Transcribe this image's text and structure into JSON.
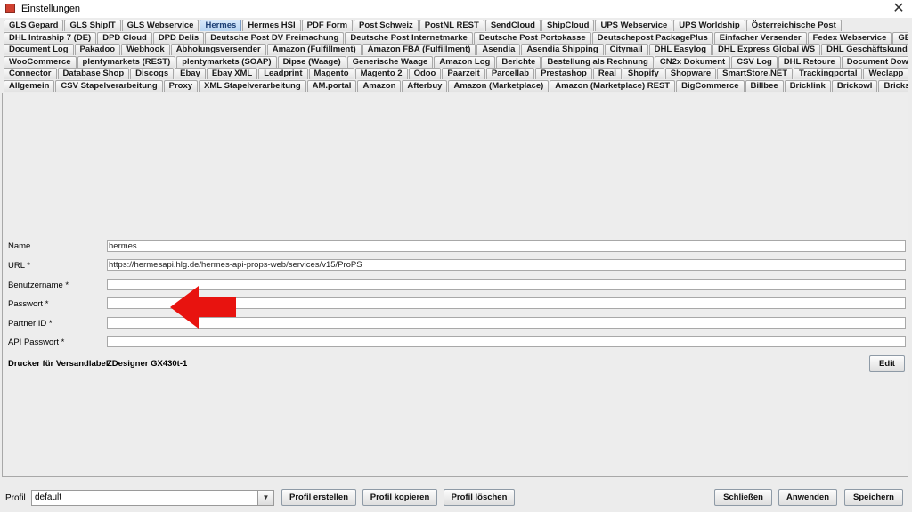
{
  "window": {
    "title": "Einstellungen",
    "close_glyph": "✕"
  },
  "tabs": {
    "rows": [
      [
        "GLS Gepard",
        "GLS ShipIT",
        "GLS Webservice",
        "Hermes",
        "Hermes HSI",
        "PDF Form",
        "Post Schweiz",
        "PostNL REST",
        "SendCloud",
        "ShipCloud",
        "UPS Webservice",
        "UPS Worldship",
        "Österreichische Post"
      ],
      [
        "DHL Intraship 7 (DE)",
        "DPD Cloud",
        "DPD Delis",
        "Deutsche Post DV Freimachung",
        "Deutsche Post Internetmarke",
        "Deutsche Post Portokasse",
        "Deutschepost PackagePlus",
        "Einfacher Versender",
        "Fedex Webservice",
        "GEL Express"
      ],
      [
        "Document Log",
        "Pakadoo",
        "Webhook",
        "Abholungsversender",
        "Amazon (Fulfillment)",
        "Amazon FBA (Fulfillment)",
        "Asendia",
        "Asendia Shipping",
        "Citymail",
        "DHL Easylog",
        "DHL Express Global WS",
        "DHL Geschäftskundenversand"
      ],
      [
        "WooCommerce",
        "plentymarkets (REST)",
        "plentymarkets (SOAP)",
        "Dipse (Waage)",
        "Generische Waage",
        "Amazon Log",
        "Berichte",
        "Bestellung als Rechnung",
        "CN2x Dokument",
        "CSV Log",
        "DHL Retoure",
        "Document Downloader"
      ],
      [
        "Connector",
        "Database Shop",
        "Discogs",
        "Ebay",
        "Ebay XML",
        "Leadprint",
        "Magento",
        "Magento 2",
        "Odoo",
        "Paarzeit",
        "Parcellab",
        "Prestashop",
        "Real",
        "Shopify",
        "Shopware",
        "SmartStore.NET",
        "Trackingportal",
        "Weclapp"
      ],
      [
        "Allgemein",
        "CSV Stapelverarbeitung",
        "Proxy",
        "XML Stapelverarbeitung",
        "AM.portal",
        "Amazon",
        "Afterbuy",
        "Amazon (Marketplace)",
        "Amazon (Marketplace) REST",
        "BigCommerce",
        "Billbee",
        "Bricklink",
        "Brickowl",
        "Brickscout"
      ]
    ],
    "selected": "Hermes"
  },
  "form": {
    "name_label": "Name",
    "name_value": "hermes",
    "url_label": "URL *",
    "url_value": "https://hermesapi.hlg.de/hermes-api-props-web/services/v15/ProPS",
    "user_label": "Benutzername *",
    "user_value": "",
    "password_label": "Passwort *",
    "password_value": "",
    "partner_label": "Partner ID *",
    "partner_value": "",
    "api_password_label": "API Passwort *",
    "api_password_value": "",
    "printer_label": "Drucker für Versandlabel",
    "printer_value": "ZDesigner GX430t-1",
    "edit_label": "Edit"
  },
  "annotation": {
    "arrow_color": "#e8130f",
    "arrow_icon": "left-arrow-icon"
  },
  "footer": {
    "profil_label": "Profil",
    "profil_value": "default",
    "dropdown_glyph": "▼",
    "create_label": "Profil erstellen",
    "copy_label": "Profil kopieren",
    "delete_label": "Profil löschen",
    "close_label": "Schließen",
    "apply_label": "Anwenden",
    "save_label": "Speichern"
  }
}
